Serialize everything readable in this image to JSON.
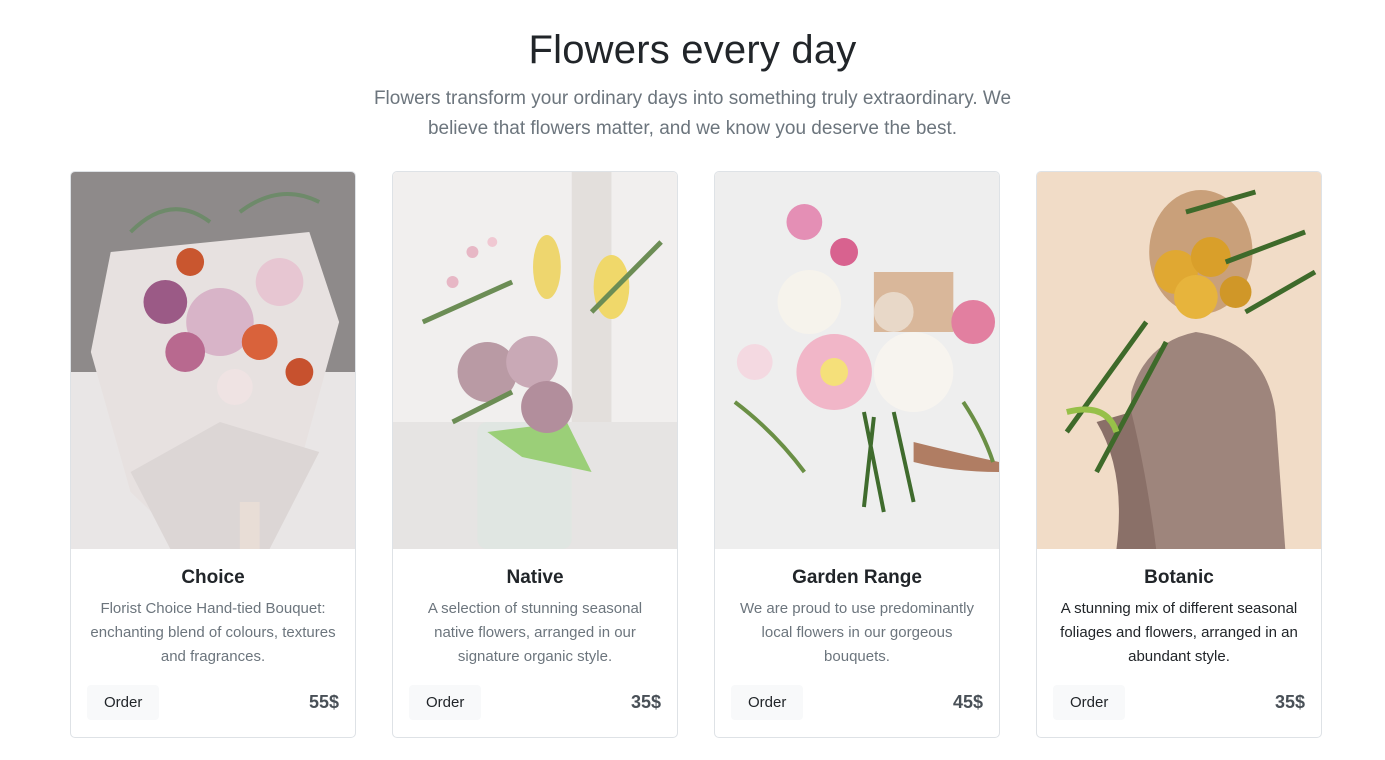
{
  "header": {
    "title": "Flowers every day",
    "subtitle": "Flowers transform your ordinary days into something truly extraordinary. We believe that flowers matter, and we know you deserve the best."
  },
  "cards": [
    {
      "title": "Choice",
      "text": "Florist Choice Hand-tied Bouquet: enchanting blend of colours, textures and fragrances.",
      "button": "Order",
      "price": "55$"
    },
    {
      "title": "Native",
      "text": "A selection of stunning seasonal native flowers, arranged in our signature organic style.",
      "button": "Order",
      "price": "35$"
    },
    {
      "title": "Garden Range",
      "text": "We are proud to use predominantly local flowers in our gorgeous bouquets.",
      "button": "Order",
      "price": "45$"
    },
    {
      "title": "Botanic",
      "text": "A stunning mix of different seasonal foliages and flowers, arranged in an abundant style.",
      "button": "Order",
      "price": "35$"
    }
  ]
}
